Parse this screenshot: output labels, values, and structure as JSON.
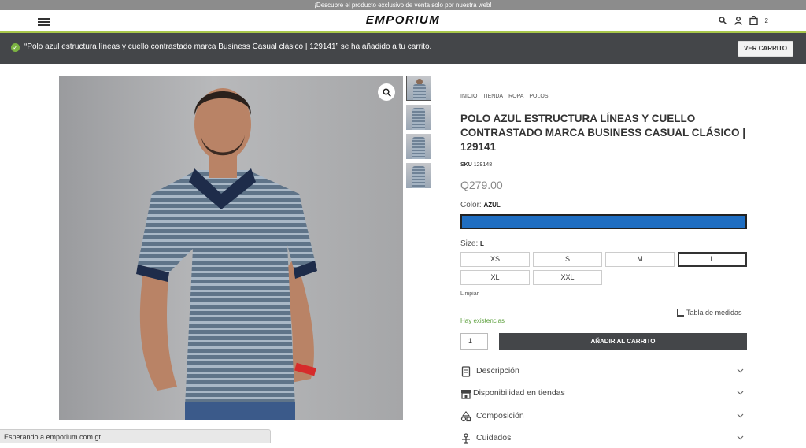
{
  "promo": {
    "text": "¡Descubre el producto exclusivo de venta solo por nuestra web!"
  },
  "header": {
    "logo": "EMPORIUM",
    "cart_count": "2"
  },
  "notice": {
    "message": "“Polo azul estructura líneas y cuello contrastado marca Business Casual clásico | 129141” se ha añadido a tu carrito.",
    "button": "VER CARRITO"
  },
  "product": {
    "breadcrumbs": [
      "INICIO",
      "TIENDA",
      "ROPA",
      "POLOS"
    ],
    "title": "POLO AZUL ESTRUCTURA LÍNEAS Y CUELLO CONTRASTADO MARCA BUSINESS CASUAL CLÁSICO | 129141",
    "sku_label": "SKU",
    "sku": "129148",
    "price": "Q279.00",
    "color_label": "Color:",
    "color_value": "AZUL",
    "swatch_color": "#1f6ec2",
    "size_label": "Size:",
    "size_value": "L",
    "sizes": [
      "XS",
      "S",
      "M",
      "L",
      "XL",
      "XXL"
    ],
    "clear_label": "Limpiar",
    "measure_label": "Tabla de medidas",
    "stock": "Hay existencias",
    "quantity": "1",
    "add_button": "AÑADIR AL CARRITO",
    "accordions": [
      {
        "label": "Descripción",
        "icon": "document-icon"
      },
      {
        "label": "Disponibilidad en tiendas",
        "icon": "store-icon"
      },
      {
        "label": "Composición",
        "icon": "shapes-icon"
      },
      {
        "label": "Cuidados",
        "icon": "care-icon"
      }
    ]
  },
  "status_bar": {
    "text": "Esperando a emporium.com.gt..."
  },
  "colors": {
    "dark": "#444649",
    "accent_green": "#a8c64a",
    "stock_green": "#5a9e3a"
  }
}
